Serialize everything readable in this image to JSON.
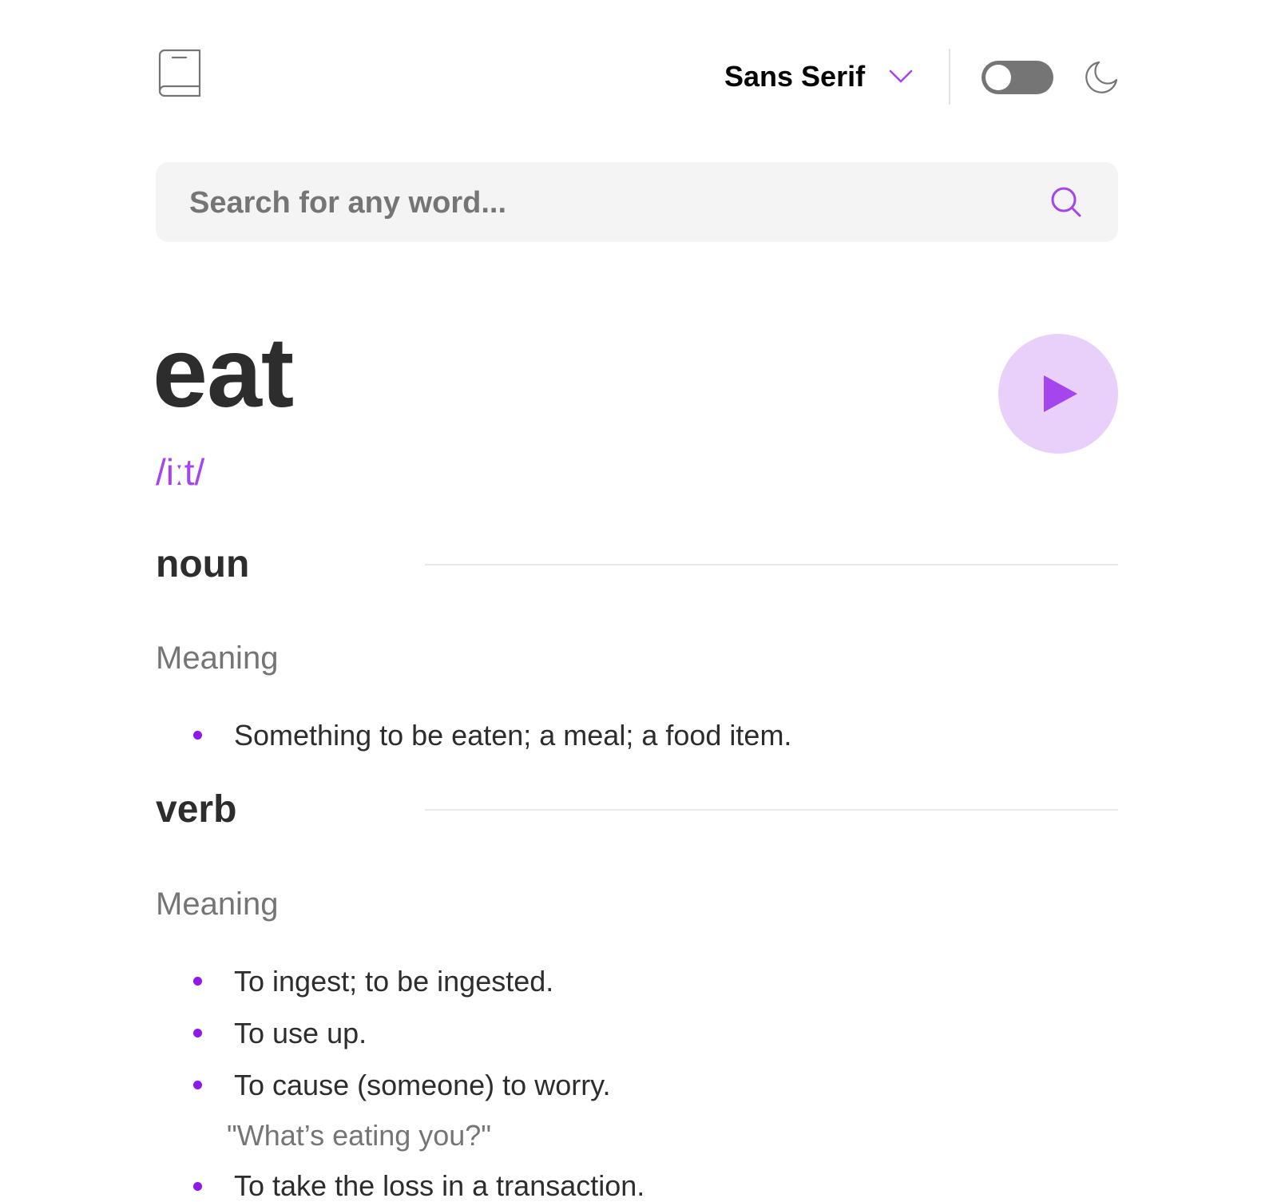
{
  "header": {
    "font_label": "Sans Serif",
    "theme_toggle_on": false
  },
  "search": {
    "placeholder": "Search for any word...",
    "value": ""
  },
  "entry": {
    "word": "eat",
    "phonetic": "/iːt/",
    "meanings": [
      {
        "part_of_speech": "noun",
        "heading": "Meaning",
        "definitions": [
          {
            "text": "Something to be eaten; a meal; a food item."
          }
        ]
      },
      {
        "part_of_speech": "verb",
        "heading": "Meaning",
        "definitions": [
          {
            "text": "To ingest; to be ingested."
          },
          {
            "text": "To use up."
          },
          {
            "text": "To cause (someone) to worry.",
            "example": "\"What’s eating you?\""
          },
          {
            "text": "To take the loss in a transaction."
          }
        ]
      }
    ]
  },
  "colors": {
    "accent": "#a445ed",
    "bullet": "#8f19e8",
    "play_bg": "#e9d0fa",
    "text": "#2d2d2d",
    "muted": "#757575",
    "search_bg": "#f4f4f4"
  },
  "icons": {
    "logo": "book-icon",
    "dropdown": "chevron-down-icon",
    "theme": "moon-icon",
    "search": "search-icon",
    "play": "play-icon"
  }
}
